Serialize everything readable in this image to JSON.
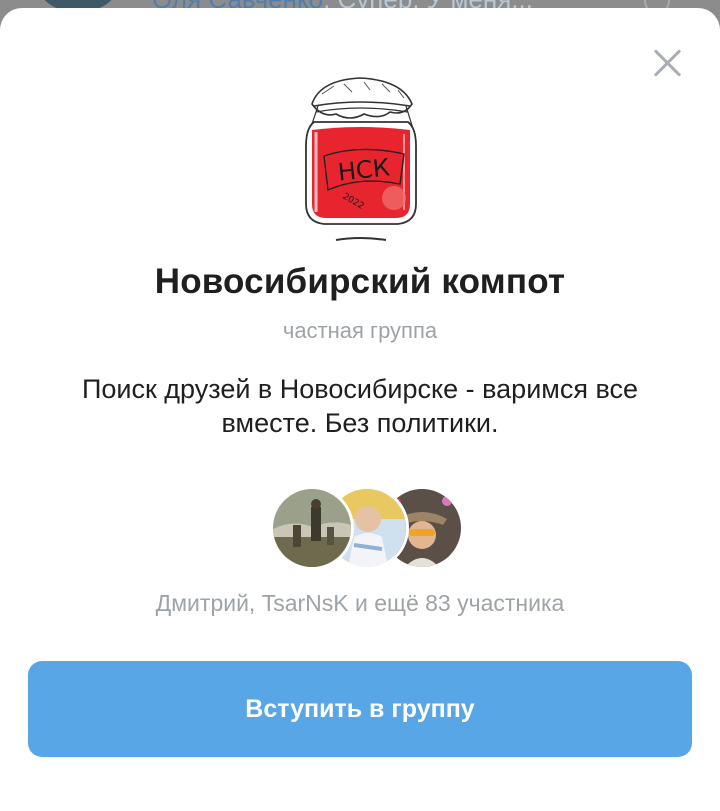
{
  "background_chat": {
    "sender": "Оля Савченко",
    "message_preview": "Супер. У меня..."
  },
  "group": {
    "title": "Новосибирский компот",
    "type_label": "частная группа",
    "description": "Поиск друзей в Новосибирске - варимся все вместе. Без политики.",
    "avatar_text": "НСК",
    "avatar_year": "2022",
    "members_summary": "Дмитрий, TsarNsK и ещё 83 участника"
  },
  "actions": {
    "join_label": "Вступить в группу"
  },
  "colors": {
    "accent": "#58a6e6",
    "jam": "#e8252f",
    "muted_text": "#9ea3a8"
  }
}
